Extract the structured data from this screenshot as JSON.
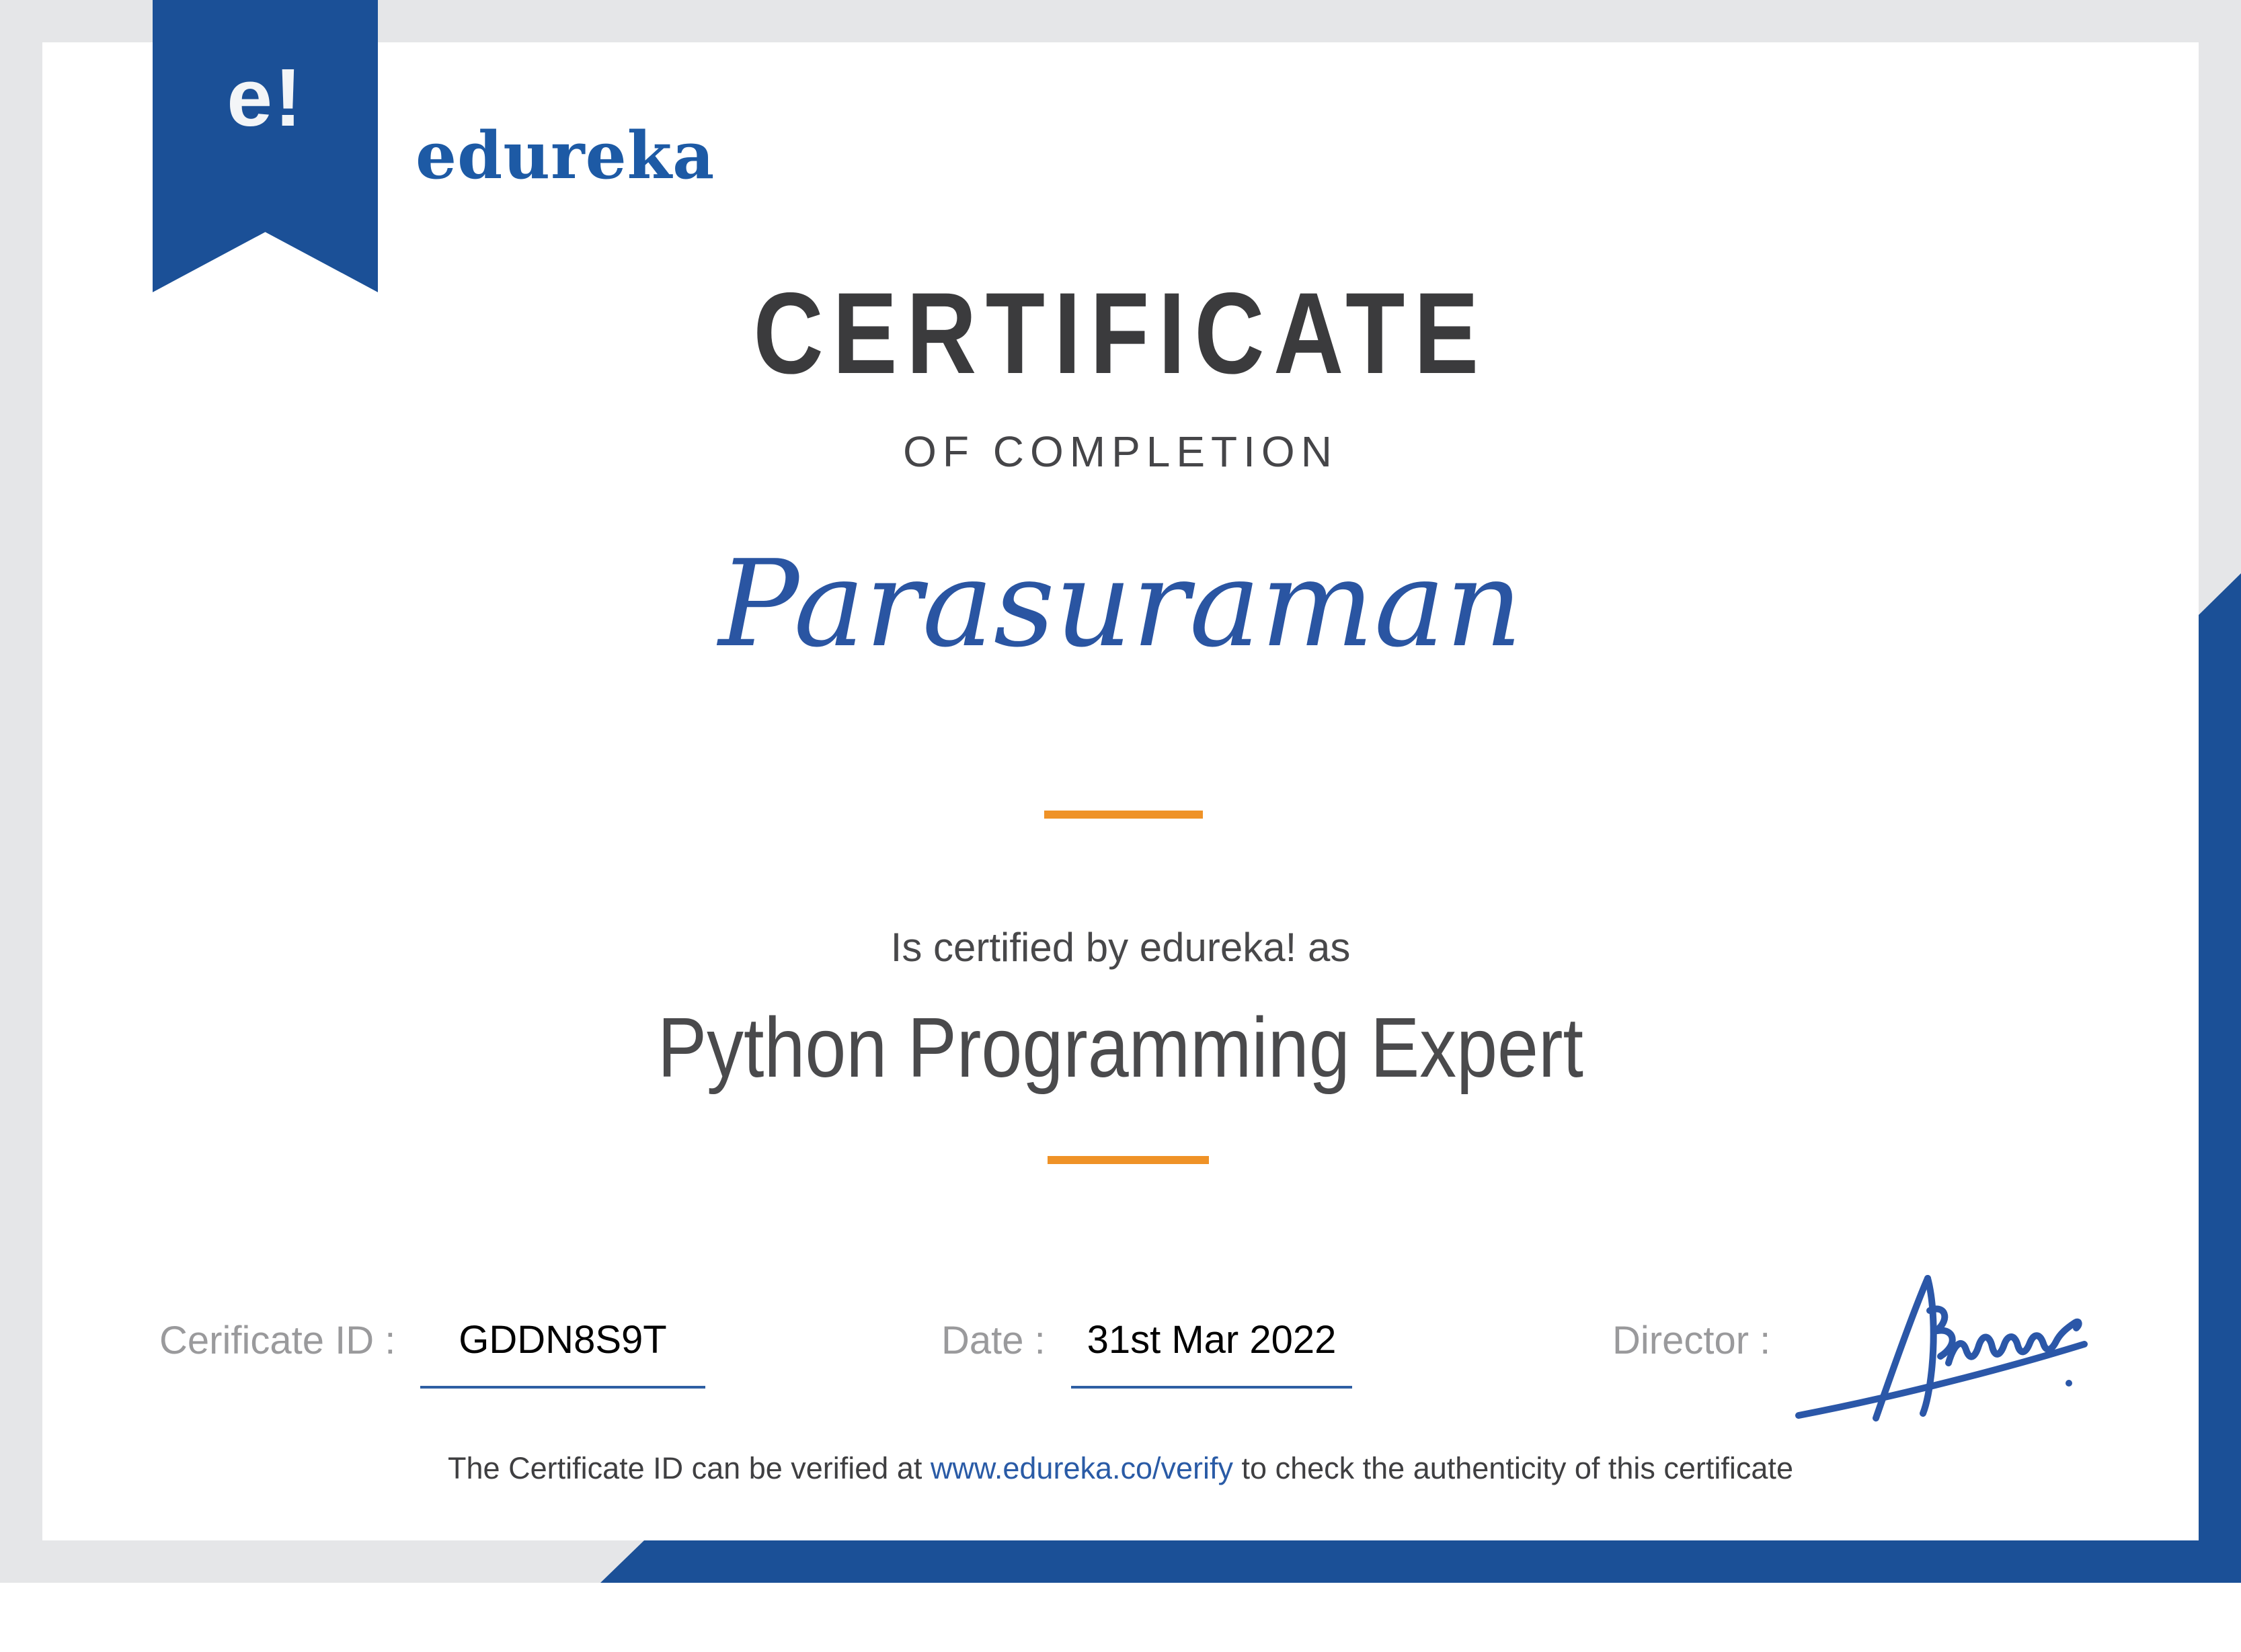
{
  "brand": {
    "mark": "e!",
    "name": "edureka"
  },
  "title": {
    "text": "CERTIFICATE"
  },
  "subtitle": {
    "text": "OF COMPLETION"
  },
  "recipient": {
    "name": "Parasuraman"
  },
  "body": {
    "certified_line": "Is certified by edureka! as",
    "program": "Python Programming Expert"
  },
  "fields": {
    "id_label": "Cerificate ID :",
    "id_value": "GDDN8S9T",
    "date_label": "Date :",
    "date_value": "31st Mar 2022",
    "director_label": "Director :"
  },
  "footer": {
    "prefix": "The Certificate ID can be verified at ",
    "link": "www.edureka.co/verify",
    "suffix": " to check the authenticity of this certificate"
  },
  "colors": {
    "brand_blue": "#1b5097",
    "wordmark_blue": "#1d5aa5",
    "accent_orange": "#ef9227",
    "frame_gray": "#e5e6e8",
    "underline_blue": "#2e5fa3",
    "link_blue": "#2a5ba6",
    "title_gray": "#3b3b3d"
  }
}
